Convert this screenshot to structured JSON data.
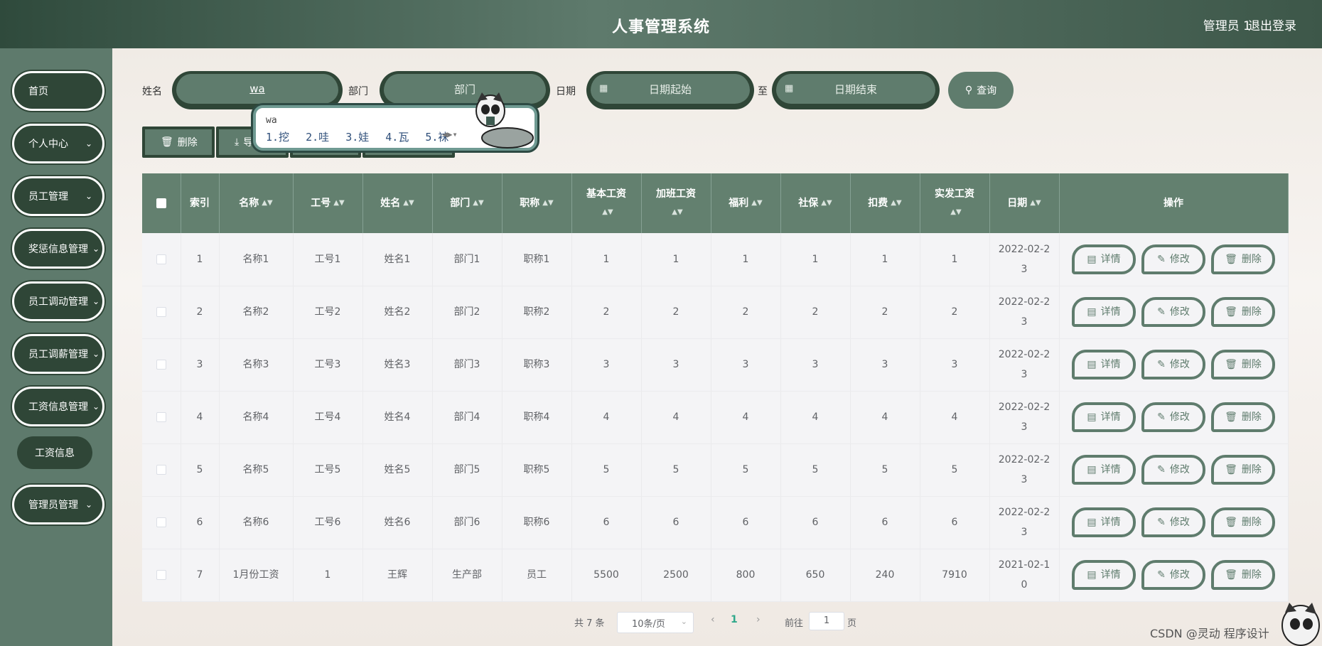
{
  "header": {
    "title": "人事管理系统",
    "user": "管理员 1",
    "logout": "退出登录"
  },
  "sidebar": {
    "items": [
      {
        "label": "首页"
      },
      {
        "label": "个人中心"
      },
      {
        "label": "员工管理"
      },
      {
        "label": "奖惩信息管理"
      },
      {
        "label": "员工调动管理"
      },
      {
        "label": "员工调薪管理"
      },
      {
        "label": "工资信息管理"
      },
      {
        "label": "管理员管理"
      }
    ],
    "submenu": {
      "label": "工资信息"
    }
  },
  "search": {
    "name_label": "姓名",
    "name_value": "wa",
    "dept_label": "部门",
    "dept_placeholder": "部门",
    "date_label": "日期",
    "date_start": "日期起始",
    "to_label": "至",
    "date_end": "日期结束",
    "button": "查询"
  },
  "toolbar": {
    "delete": "删除",
    "export": "导"
  },
  "ime": {
    "composition": "wa",
    "candidates": [
      "1.挖",
      "2.哇",
      "3.娃",
      "4.瓦",
      "5.袜"
    ]
  },
  "table": {
    "headers": [
      "索引",
      "名称",
      "工号",
      "姓名",
      "部门",
      "职称",
      "基本工资",
      "加班工资",
      "福利",
      "社保",
      "扣费",
      "实发工资",
      "日期",
      "操作"
    ],
    "rows": [
      [
        "1",
        "名称1",
        "工号1",
        "姓名1",
        "部门1",
        "职称1",
        "1",
        "1",
        "1",
        "1",
        "1",
        "1",
        "2022-02-23"
      ],
      [
        "2",
        "名称2",
        "工号2",
        "姓名2",
        "部门2",
        "职称2",
        "2",
        "2",
        "2",
        "2",
        "2",
        "2",
        "2022-02-23"
      ],
      [
        "3",
        "名称3",
        "工号3",
        "姓名3",
        "部门3",
        "职称3",
        "3",
        "3",
        "3",
        "3",
        "3",
        "3",
        "2022-02-23"
      ],
      [
        "4",
        "名称4",
        "工号4",
        "姓名4",
        "部门4",
        "职称4",
        "4",
        "4",
        "4",
        "4",
        "4",
        "4",
        "2022-02-23"
      ],
      [
        "5",
        "名称5",
        "工号5",
        "姓名5",
        "部门5",
        "职称5",
        "5",
        "5",
        "5",
        "5",
        "5",
        "5",
        "2022-02-23"
      ],
      [
        "6",
        "名称6",
        "工号6",
        "姓名6",
        "部门6",
        "职称6",
        "6",
        "6",
        "6",
        "6",
        "6",
        "6",
        "2022-02-23"
      ],
      [
        "7",
        "1月份工资",
        "1",
        "王辉",
        "生产部",
        "员工",
        "5500",
        "2500",
        "800",
        "650",
        "240",
        "7910",
        "2021-02-10"
      ]
    ],
    "actions": {
      "detail": "详情",
      "edit": "修改",
      "delete": "删除"
    }
  },
  "pager": {
    "total": "共 7 条",
    "page_size": "10条/页",
    "current": "1",
    "goto_label": "前往",
    "goto_value": "1",
    "page_unit": "页"
  },
  "watermark": "CSDN @灵动 程序设计"
}
